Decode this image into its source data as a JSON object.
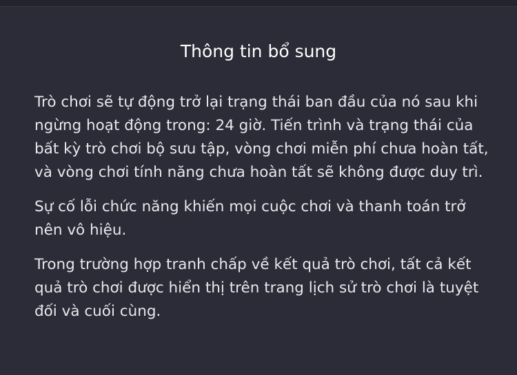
{
  "info_panel": {
    "title": "Thông tin bổ sung",
    "paragraphs": [
      "Trò chơi sẽ tự động trở lại trạng thái ban đầu của nó sau khi ngừng hoạt động trong: 24 giờ. Tiến trình và trạng thái của bất kỳ trò chơi bộ sưu tập, vòng chơi miễn phí chưa hoàn tất, và vòng chơi tính năng chưa hoàn tất sẽ không được duy trì.",
      "Sự cố lỗi chức năng khiến mọi cuộc chơi và thanh toán trở nên vô hiệu.",
      "Trong trường hợp tranh chấp về kết quả trò chơi, tất cả kết quả trò chơi được hiển thị trên trang lịch sử trò chơi là tuyệt đối và cuối cùng."
    ]
  },
  "colors": {
    "background": "#2c2c38",
    "title_text": "#ffffff",
    "body_text": "#e8e8ec"
  }
}
